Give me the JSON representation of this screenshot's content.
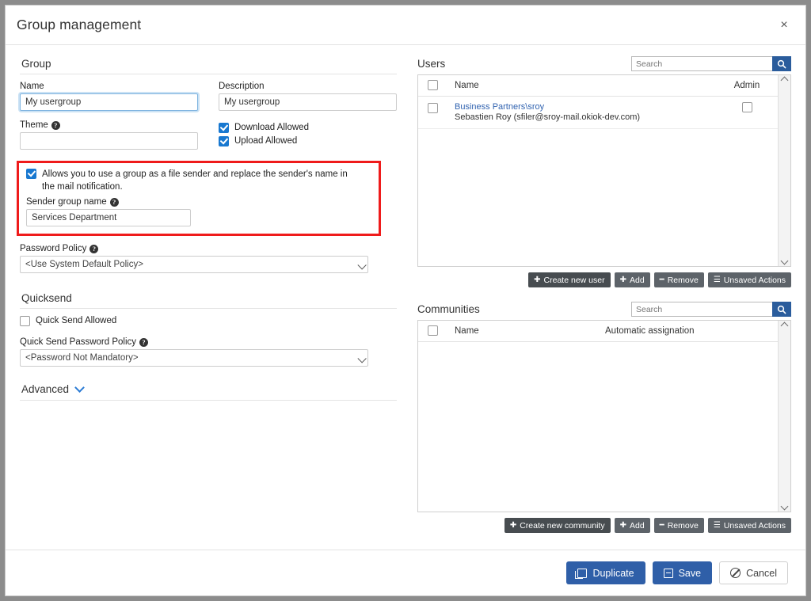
{
  "dialog": {
    "title": "Group management",
    "close_label": "×"
  },
  "left": {
    "group_section": {
      "heading": "Group",
      "name_label": "Name",
      "name_value": "My usergroup",
      "description_label": "Description",
      "description_value": "My usergroup",
      "theme_label": "Theme",
      "theme_value": "",
      "download_allowed_label": "Download Allowed",
      "download_allowed_checked": true,
      "upload_allowed_label": "Upload Allowed",
      "upload_allowed_checked": true
    },
    "sender_box": {
      "checkbox_label": "Allows you to use a group as a file sender and replace the sender's name in the mail notification.",
      "checkbox_checked": true,
      "sender_group_name_label": "Sender group name",
      "sender_group_name_value": "Services Department",
      "highlight_color": "#ef1b1b"
    },
    "password_policy": {
      "label": "Password Policy",
      "value": "<Use System Default Policy>"
    },
    "quicksend": {
      "heading": "Quicksend",
      "quick_send_allowed_label": "Quick Send Allowed",
      "quick_send_allowed_checked": false,
      "policy_label": "Quick Send Password Policy",
      "policy_value": "<Password Not Mandatory>"
    },
    "advanced": {
      "label": "Advanced"
    }
  },
  "right": {
    "users": {
      "title": "Users",
      "search_placeholder": "Search",
      "search_value": "",
      "columns": {
        "name": "Name",
        "admin": "Admin"
      },
      "select_all_checked": false,
      "rows": [
        {
          "selected": false,
          "name": "Business Partners\\sroy",
          "detail": "Sebastien Roy (sfiler@sroy-mail.okiok-dev.com)",
          "admin_checked": false
        }
      ],
      "buttons": [
        {
          "label": "Create new user",
          "icon": "plus-icon",
          "style": "dark"
        },
        {
          "label": "Add",
          "icon": "plus-icon",
          "style": "gray"
        },
        {
          "label": "Remove",
          "icon": "minus-icon",
          "style": "gray"
        },
        {
          "label": "Unsaved Actions",
          "icon": "list-icon",
          "style": "gray"
        }
      ]
    },
    "communities": {
      "title": "Communities",
      "search_placeholder": "Search",
      "search_value": "",
      "columns": {
        "name": "Name",
        "automatic": "Automatic assignation"
      },
      "select_all_checked": false,
      "rows": [],
      "buttons": [
        {
          "label": "Create new community",
          "icon": "plus-icon",
          "style": "dark"
        },
        {
          "label": "Add",
          "icon": "plus-icon",
          "style": "gray"
        },
        {
          "label": "Remove",
          "icon": "minus-icon",
          "style": "gray"
        },
        {
          "label": "Unsaved Actions",
          "icon": "list-icon",
          "style": "gray"
        }
      ]
    }
  },
  "footer": {
    "duplicate_label": "Duplicate",
    "save_label": "Save",
    "cancel_label": "Cancel",
    "primary_color": "#2f5fa8"
  },
  "icons": {
    "help": "?",
    "plus": "➕",
    "minus": "➖"
  }
}
